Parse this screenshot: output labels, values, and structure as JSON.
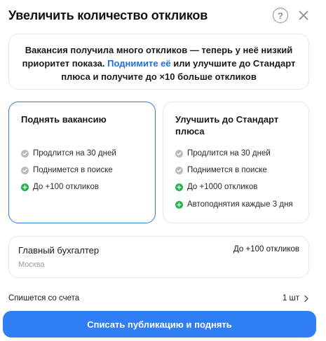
{
  "dialog": {
    "title": "Увеличить количество откликов",
    "help_icon_glyph": "?"
  },
  "notice": {
    "text_before": "Вакансия получила много откликов — теперь у неё низкий приоритет показа.",
    "link": "Поднимите её",
    "text_after": "или улучшите до Стандарт плюса и получите до ×10 больше откликов"
  },
  "options": [
    {
      "title": "Поднять вакансию",
      "selected": true,
      "features": [
        {
          "text": "Продлится на 30 дней",
          "icon": "check-gray"
        },
        {
          "text": "Поднимется в поиске",
          "icon": "check-gray"
        },
        {
          "text": "До +100 откликов",
          "icon": "plus-green"
        }
      ]
    },
    {
      "title": "Улучшить до Стандарт плюса",
      "selected": false,
      "features": [
        {
          "text": "Продлится на 30 дней",
          "icon": "check-gray"
        },
        {
          "text": "Поднимется в поиске",
          "icon": "check-gray"
        },
        {
          "text": "До +1000 откликов",
          "icon": "plus-green"
        },
        {
          "text": "Автоподнятия каждые 3 дня",
          "icon": "plus-green"
        }
      ]
    }
  ],
  "vacancy": {
    "title": "Главный бухгалтер",
    "city": "Москва",
    "responses": "До +100 откликов"
  },
  "charge": {
    "label": "Спишется со счета",
    "count": "1 шт"
  },
  "submit_label": "Списать публикацию и поднять",
  "colors": {
    "accent": "#2f7ff3",
    "link": "#1f6fe0",
    "selected_border": "#2f7be8",
    "green": "#23b24d",
    "gray_icon": "#b7bbc1"
  }
}
